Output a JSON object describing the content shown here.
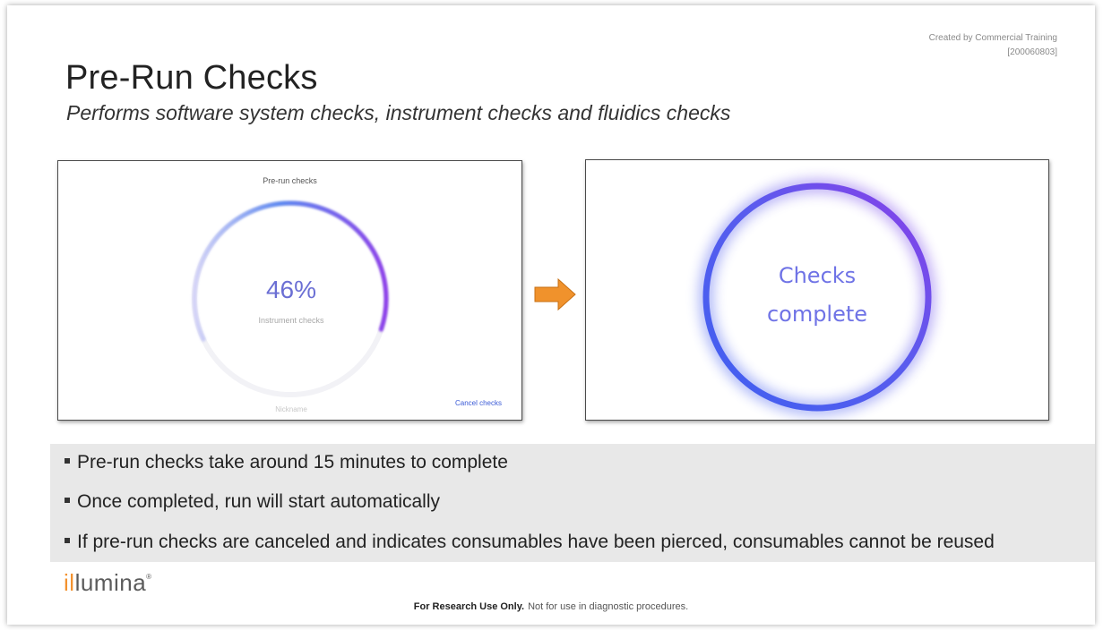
{
  "credit": {
    "line1": "Created by Commercial Training",
    "line2": "[200060803]"
  },
  "title": "Pre-Run Checks",
  "subtitle": "Performs software system checks, instrument checks and fluidics checks",
  "left_screen": {
    "header": "Pre-run checks",
    "percent": "46%",
    "progress": 0.46,
    "status": "Instrument checks",
    "nickname": "Nickname",
    "cancel_label": "Cancel checks"
  },
  "right_screen": {
    "line1": "Checks",
    "line2": "complete"
  },
  "bullets": [
    "Pre-run checks take around 15 minutes to complete",
    "Once completed, run will start automatically",
    "If pre-run checks are canceled and indicates consumables have been pierced, consumables cannot be reused"
  ],
  "logo": {
    "accent": "il",
    "rest": "lumina",
    "mark": "®"
  },
  "footer": {
    "bold": "For Research Use Only.",
    "normal": "Not for use in diagnostic procedures."
  },
  "colors": {
    "ring_start": "#c9c8f5",
    "ring_mid": "#5b86f0",
    "ring_end": "#8a3ee8",
    "arrow": "#f0922c",
    "accent_text": "#6b6fd4",
    "logo_orange": "#f3922f"
  }
}
